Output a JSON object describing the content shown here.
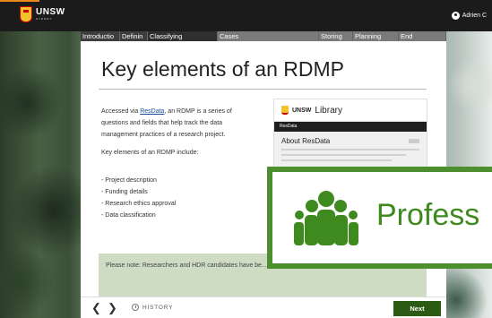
{
  "header": {
    "logo_text": "UNSW",
    "logo_sub": "SYDNEY",
    "user_name": "Adrien C"
  },
  "nav": {
    "items": [
      {
        "label": "Introductio",
        "state": "done"
      },
      {
        "label": "Definin",
        "state": "done"
      },
      {
        "label": "Classifying",
        "state": "current"
      },
      {
        "label": "Cases",
        "state": "todo"
      },
      {
        "label": "Storing",
        "state": "todo"
      },
      {
        "label": "Planning",
        "state": "todo"
      },
      {
        "label": "End",
        "state": "todo"
      }
    ]
  },
  "main": {
    "title": "Key elements of an RDMP",
    "intro_prefix": "Accessed via ",
    "intro_link": "ResData",
    "intro_suffix": ", an RDMP is a series of questions and fields that help track the data management practices of a research project.",
    "key_heading": "Key elements of an RDMP include:",
    "list": [
      "- Project description",
      "- Funding details",
      "- Research ethics approval",
      "- Data classification"
    ],
    "note": "Please note: Researchers and HDR candidates have be... an RDMP in a separate training module."
  },
  "screenshot": {
    "unsw": "UNSW",
    "library": "Library",
    "bar": "ResData",
    "heading": "About ResData"
  },
  "overlay": {
    "text": "Profess",
    "color": "#4d8f2c"
  },
  "footer": {
    "history_label": "HISTORY",
    "next_label": "Next"
  },
  "colors": {
    "accent_green": "#2b5a14",
    "note_bg": "#cfdcc4",
    "top_orange": "#e88a1a"
  }
}
